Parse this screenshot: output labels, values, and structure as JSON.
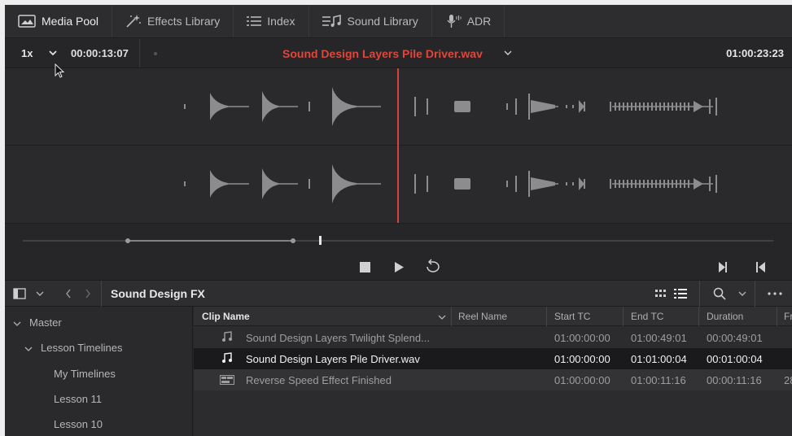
{
  "toolbar": {
    "media_pool": "Media Pool",
    "effects_library": "Effects Library",
    "index": "Index",
    "sound_library": "Sound Library",
    "adr": "ADR"
  },
  "viewer": {
    "speed": "1x",
    "timecode_left": "00:00:13:07",
    "clip_title": "Sound Design Layers Pile Driver.wav",
    "timecode_right": "01:00:23:23"
  },
  "pool": {
    "bin_title": "Sound Design FX"
  },
  "bins": [
    {
      "label": "Master",
      "expanded": true
    },
    {
      "label": "Lesson Timelines",
      "expanded": true
    },
    {
      "label": "My Timelines"
    },
    {
      "label": "Lesson 11"
    },
    {
      "label": "Lesson 10"
    }
  ],
  "table": {
    "columns": [
      "Clip Name",
      "Reel Name",
      "Start TC",
      "End TC",
      "Duration",
      "Fra"
    ],
    "rows": [
      {
        "icon": "audio-clip-icon",
        "name": "Sound Design Layers Twilight Splend...",
        "reel": "",
        "start": "01:00:00:00",
        "end": "01:00:49:01",
        "duration": "00:00:49:01",
        "fps": ""
      },
      {
        "icon": "audio-clip-icon",
        "name": "Sound Design Layers Pile Driver.wav",
        "reel": "",
        "start": "01:00:00:00",
        "end": "01:01:00:04",
        "duration": "00:01:00:04",
        "fps": ""
      },
      {
        "icon": "timeline-icon",
        "name": "Reverse Speed Effect Finished",
        "reel": "",
        "start": "01:00:00:00",
        "end": "01:00:11:16",
        "duration": "00:00:11:16",
        "fps": "28"
      }
    ]
  },
  "colors": {
    "playhead": "#d8403a",
    "title_red": "#e0463a",
    "waveform": "#8c8c8e"
  }
}
